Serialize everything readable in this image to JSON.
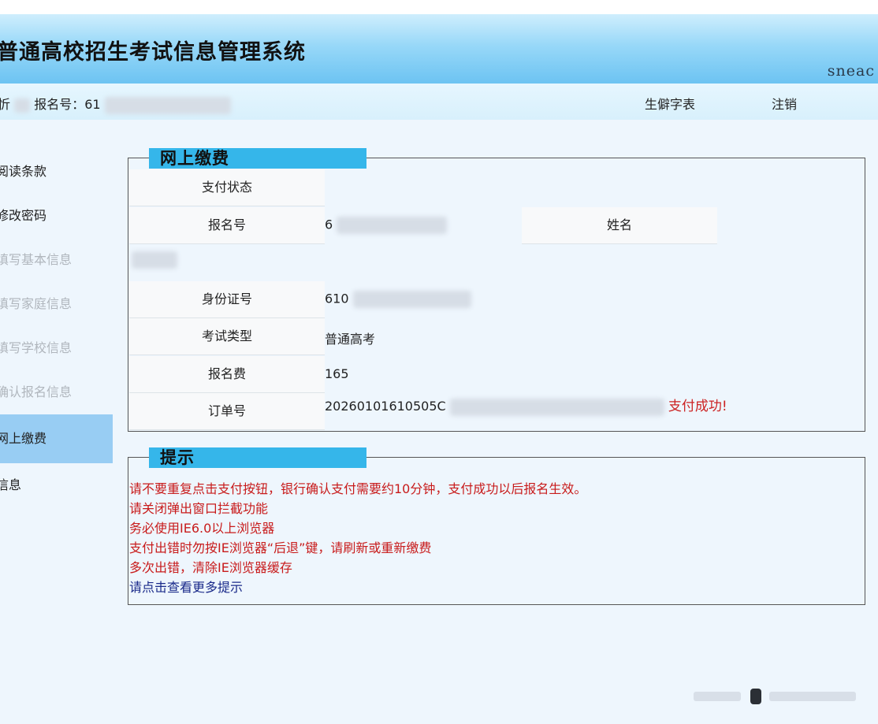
{
  "app": {
    "title": "普通高校招生考试信息管理系统",
    "brand": "sneac"
  },
  "topbar": {
    "user_prefix": "忻",
    "reg_label": "报名号：61",
    "link_dict": "生僻字表",
    "link_logout": "注销"
  },
  "sidebar": {
    "items": [
      {
        "label": "阅读条款",
        "state": "enabled"
      },
      {
        "label": "修改密码",
        "state": "enabled"
      },
      {
        "label": "填写基本信息",
        "state": "disabled"
      },
      {
        "label": "填写家庭信息",
        "state": "disabled"
      },
      {
        "label": "填写学校信息",
        "state": "disabled"
      },
      {
        "label": "确认报名信息",
        "state": "disabled"
      },
      {
        "label": "网上缴费",
        "state": "active"
      },
      {
        "label": "信息",
        "state": "enabled"
      }
    ]
  },
  "payment": {
    "legend": "网上缴费",
    "status_label": "支付状态",
    "reg_no_label": "报名号",
    "reg_no_value": "6",
    "name_label": "姓名",
    "id_label": "身份证号",
    "id_value": "610",
    "exam_type_label": "考试类型",
    "exam_type_value": "普通高考",
    "fee_label": "报名费",
    "fee_value": "165",
    "order_label": "订单号",
    "order_value": "20260101610505C",
    "success_text": "支付成功!"
  },
  "tips": {
    "legend": "提示",
    "lines": [
      "请不要重复点击支付按钮，银行确认支付需要约10分钟，支付成功以后报名生效。",
      "请关闭弹出窗口拦截功能",
      "务必使用IE6.0以上浏览器",
      "支付出错时勿按IE浏览器“后退”键，请刷新或重新缴费",
      "多次出错，清除IE浏览器缓存"
    ],
    "more_link": "请点击查看更多提示"
  },
  "colors": {
    "legend_bg": "#35b6ea",
    "active_nav": "#98cdf3",
    "tip_red": "#c81b1b",
    "link_blue": "#1a2a8a"
  }
}
